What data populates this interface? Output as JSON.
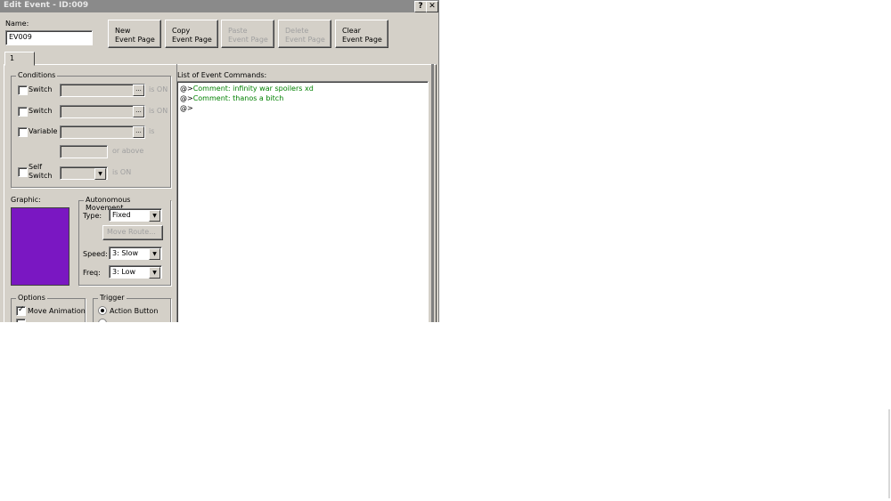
{
  "window": {
    "title": "Edit Event - ID:009",
    "help_label": "?",
    "close_label": "✕"
  },
  "name": {
    "label": "Name:",
    "value": "EV009"
  },
  "toolbar": {
    "new_page": "New\nEvent Page",
    "copy_page": "Copy\nEvent Page",
    "paste_page": "Paste\nEvent Page",
    "delete_page": "Delete\nEvent Page",
    "clear_page": "Clear\nEvent Page"
  },
  "tabs": [
    {
      "label": "1"
    }
  ],
  "conditions": {
    "title": "Conditions",
    "switch1_label": "Switch",
    "switch1_suffix": "is ON",
    "switch2_label": "Switch",
    "switch2_suffix": "is ON",
    "variable_label": "Variable",
    "variable_suffix": "is",
    "or_above": "or above",
    "self_switch_label": "Self\nSwitch",
    "self_switch_suffix": "is ON",
    "ellipsis": "..."
  },
  "graphic": {
    "label": "Graphic:",
    "color": "#7a17c2"
  },
  "movement": {
    "title": "Autonomous Movement",
    "type_label": "Type:",
    "type_value": "Fixed",
    "move_route": "Move Route...",
    "speed_label": "Speed:",
    "speed_value": "3: Slow",
    "freq_label": "Freq:",
    "freq_value": "3: Low"
  },
  "options": {
    "title": "Options",
    "move_animation": "Move Animation",
    "move_animation_checked": true
  },
  "trigger": {
    "title": "Trigger",
    "action_button": "Action Button",
    "action_button_selected": true
  },
  "commands": {
    "label": "List of Event Commands:",
    "lines": [
      {
        "prefix": "@>",
        "text": "Comment: infinity war spoilers xd"
      },
      {
        "prefix": "@>",
        "text": "Comment: thanos a bitch"
      },
      {
        "prefix": "@>",
        "text": ""
      }
    ]
  }
}
